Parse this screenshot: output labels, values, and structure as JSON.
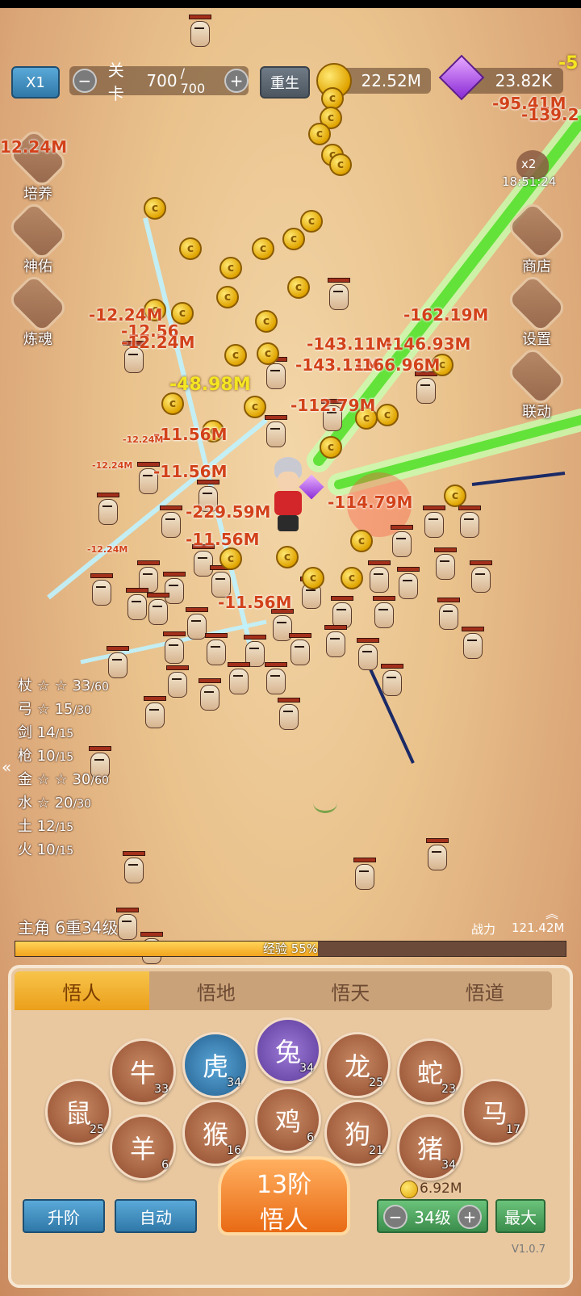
{
  "top": {
    "speed_label": "X1",
    "stage_label": "关卡",
    "stage_value": "700",
    "stage_max": "/ 700",
    "rebirth_label": "重生",
    "gold": "22.52M",
    "gems": "23.82K",
    "corner_damage": "-5"
  },
  "left_menu": [
    {
      "label": "培养",
      "icon": "cultivate-icon"
    },
    {
      "label": "神佑",
      "icon": "blessing-icon"
    },
    {
      "label": "炼魂",
      "icon": "soul-refine-icon"
    }
  ],
  "right_menu": {
    "boost_badge": "x2",
    "boost_timer": "18:51:24",
    "items": [
      {
        "label": "商店",
        "icon": "diamond-icon"
      },
      {
        "label": "设置",
        "icon": "gear-icon"
      },
      {
        "label": "联动",
        "icon": "link-icon"
      }
    ]
  },
  "damage_numbers": [
    {
      "text": "-95.41M",
      "kind": "big"
    },
    {
      "text": "-139.2",
      "kind": "big"
    },
    {
      "text": "12.24M",
      "kind": "big"
    },
    {
      "text": "-12.24M",
      "kind": "big"
    },
    {
      "text": "-12.56",
      "kind": "big"
    },
    {
      "text": "-12.24M",
      "kind": "big"
    },
    {
      "text": "-162.19M",
      "kind": "big"
    },
    {
      "text": "-143.11M",
      "kind": "big"
    },
    {
      "text": "-146.93M",
      "kind": "big"
    },
    {
      "text": "-143.11M",
      "kind": "big"
    },
    {
      "text": "-166.96M",
      "kind": "big"
    },
    {
      "text": "-48.98M",
      "kind": "yellow"
    },
    {
      "text": "-112.79M",
      "kind": "big"
    },
    {
      "text": "-11.56M",
      "kind": "big"
    },
    {
      "text": "-229.59M",
      "kind": "big"
    },
    {
      "text": "-11.56M",
      "kind": "big"
    },
    {
      "text": "-114.79M",
      "kind": "big"
    },
    {
      "text": "-11.56M",
      "kind": "big"
    },
    {
      "text": "-11.56M",
      "kind": "big"
    },
    {
      "text": "-12.24M",
      "kind": "small"
    },
    {
      "text": "-12.24M",
      "kind": "small"
    },
    {
      "text": "-12.24M",
      "kind": "small"
    }
  ],
  "weapons": [
    {
      "name": "杖",
      "stars": "☆ ☆",
      "value": "33",
      "max": "/60"
    },
    {
      "name": "弓",
      "stars": "☆",
      "value": "15",
      "max": "/30"
    },
    {
      "name": "剑",
      "stars": "",
      "value": "14",
      "max": "/15"
    },
    {
      "name": "枪",
      "stars": "",
      "value": "10",
      "max": "/15"
    },
    {
      "name": "金",
      "stars": "☆ ☆",
      "value": "30",
      "max": "/60"
    },
    {
      "name": "水",
      "stars": "☆",
      "value": "20",
      "max": "/30"
    },
    {
      "name": "土",
      "stars": "",
      "value": "12",
      "max": "/15"
    },
    {
      "name": "火",
      "stars": "",
      "value": "10",
      "max": "/15"
    }
  ],
  "player": {
    "title": "主角 6重34级",
    "power_label": "战力",
    "power_value": "121.42M",
    "exp_label": "经验 55%",
    "exp_fraction": 0.55
  },
  "tabs": [
    "悟人",
    "悟地",
    "悟天",
    "悟道"
  ],
  "zodiac": [
    {
      "name": "rat",
      "glyph": "鼠",
      "level": "25"
    },
    {
      "name": "ox",
      "glyph": "牛",
      "level": "33"
    },
    {
      "name": "tiger",
      "glyph": "虎",
      "level": "34"
    },
    {
      "name": "rabbit",
      "glyph": "兔",
      "level": "34"
    },
    {
      "name": "dragon",
      "glyph": "龙",
      "level": "25"
    },
    {
      "name": "snake",
      "glyph": "蛇",
      "level": "23"
    },
    {
      "name": "horse",
      "glyph": "马",
      "level": "17"
    },
    {
      "name": "goat",
      "glyph": "羊",
      "level": "6"
    },
    {
      "name": "monkey",
      "glyph": "猴",
      "level": "16"
    },
    {
      "name": "rooster",
      "glyph": "鸡",
      "level": "6"
    },
    {
      "name": "dog",
      "glyph": "狗",
      "level": "21"
    },
    {
      "name": "pig",
      "glyph": "猪",
      "level": "34"
    }
  ],
  "bottom": {
    "upgrade_label": "升阶",
    "auto_label": "自动",
    "rank_line1": "13阶",
    "rank_line2": "悟人",
    "cost": "6.92M",
    "level_label": "34级",
    "max_label": "最大",
    "version": "V1.0.7"
  },
  "colors": {
    "sand": "#e9c28c",
    "laser_green": "#7cf24a",
    "laser_cyan": "#7fe0f0",
    "damage": "#d2421a",
    "tab_active": "#f2b232"
  }
}
